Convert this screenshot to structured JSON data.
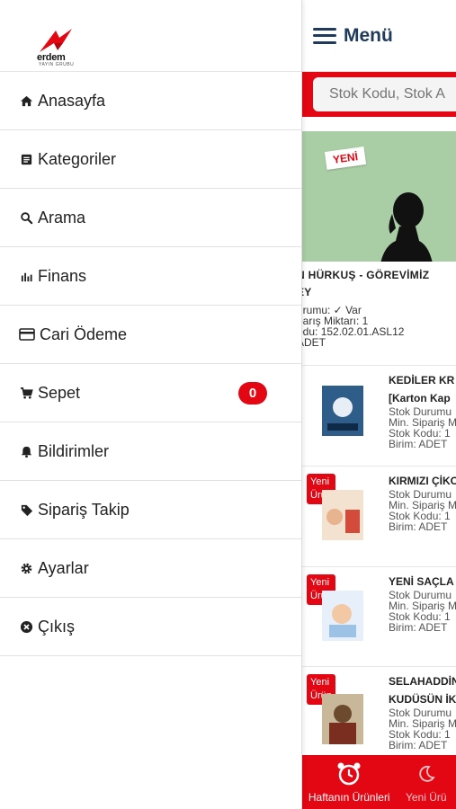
{
  "brand": {
    "logo_text": "erdem",
    "logo_sub": "YAYIN GRUBU",
    "accent": "#e30613",
    "navy": "#1f3a5a"
  },
  "drawer": {
    "items": [
      {
        "label": "Anasayfa",
        "icon": "home-icon"
      },
      {
        "label": "Kategoriler",
        "icon": "list-icon"
      },
      {
        "label": "Arama",
        "icon": "search-icon"
      },
      {
        "label": "Finans",
        "icon": "bar-chart-icon"
      },
      {
        "label": "Cari Ödeme",
        "icon": "credit-card-icon"
      },
      {
        "label": "Sepet",
        "icon": "cart-icon",
        "badge": "0"
      },
      {
        "label": "Bildirimler",
        "icon": "bell-icon"
      },
      {
        "label": "Sipariş Takip",
        "icon": "tag-icon"
      },
      {
        "label": "Ayarlar",
        "icon": "gear-icon"
      },
      {
        "label": "Çıkış",
        "icon": "close-circle-icon"
      }
    ]
  },
  "main": {
    "header_title": "Menü",
    "search_placeholder": "Stok Kodu, Stok A",
    "featured": {
      "tag": "YENİ",
      "title_line1": "N HÜRKUŞ - GÖREVİMİZ",
      "title_line2": "EY",
      "stock": "urumu: ✓ Var",
      "min_order": "parış Miktarı: 1",
      "stock_code": "odu: 152.02.01.ASL12",
      "unit": "ADET"
    },
    "products": [
      {
        "badge": "",
        "title1": "KEDİLER KR",
        "title2": "[Karton Kap",
        "meta": [
          "Stok Durumu",
          "Min. Sipariş M",
          "Stok Kodu: 1",
          "Birim: ADET"
        ]
      },
      {
        "badge": "Yeni Ürün",
        "title1": "KIRMIZI ÇİKO",
        "title2": "",
        "meta": [
          "Stok Durumu",
          "Min. Sipariş M",
          "Stok Kodu: 1",
          "Birim: ADET"
        ]
      },
      {
        "badge": "Yeni Ürün",
        "title1": "YENİ SAÇLA",
        "title2": "",
        "meta": [
          "Stok Durumu",
          "Min. Sipariş M",
          "Stok Kodu: 1",
          "Birim: ADET"
        ]
      },
      {
        "badge": "Yeni Ürün",
        "title1": "SELAHADDİN",
        "title2": "KUDÜSÜN İK",
        "meta": [
          "Stok Durumu",
          "Min. Sipariş M",
          "Stok Kodu: 1",
          "Birim: ADET"
        ]
      }
    ],
    "tabs": [
      {
        "label": "Haftanın Ürünleri",
        "icon": "alarm-clock-icon"
      },
      {
        "label": "Yeni Ürü",
        "icon": "moon-icon"
      }
    ]
  }
}
